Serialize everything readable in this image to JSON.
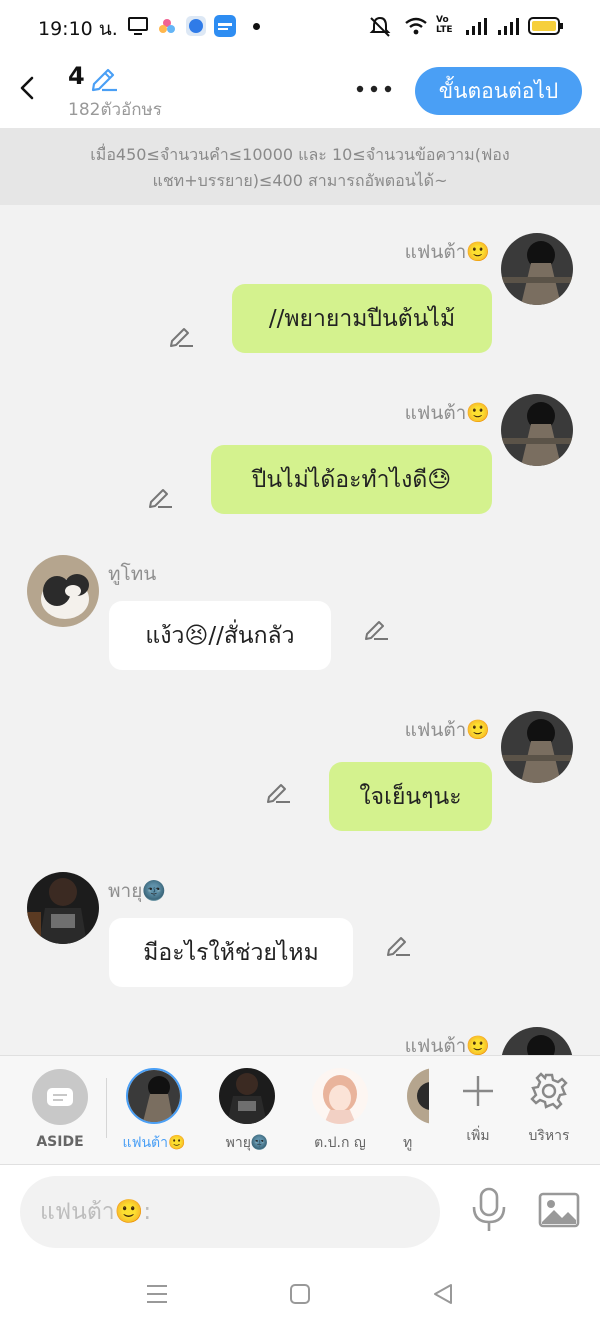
{
  "status": {
    "time": "19:10 น.",
    "volte": "Vo LTE"
  },
  "header": {
    "chapter_number": "4",
    "char_count": "182ตัวอักษร",
    "next_button": "ขั้นตอนต่อไป"
  },
  "notice": {
    "line1": "เมื่อ450≤จำนวนคำ≤10000 และ 10≤จำนวนข้อความ(ฟอง",
    "line2": "แชท+บรรยาย)≤400 สามารถอัพตอนได้~"
  },
  "messages": [
    {
      "side": "right",
      "speaker": "แฟนต้า🙂",
      "text": "//พยายามปีนต้นไม้"
    },
    {
      "side": "right",
      "speaker": "แฟนต้า🙂",
      "text": "ปีนไม่ได้อะทำไงดี😓"
    },
    {
      "side": "left",
      "speaker": "ทูโทน",
      "text": "แง้ว😣//สั่นกลัว"
    },
    {
      "side": "right",
      "speaker": "แฟนต้า🙂",
      "text": "ใจเย็นๆนะ"
    },
    {
      "side": "left",
      "speaker": "พายุ🌚",
      "text": "มีอะไรให้ช่วยไหม"
    },
    {
      "side": "right",
      "speaker": "แฟนต้า🙂",
      "text": ""
    }
  ],
  "characters": {
    "aside_label": "ASIDE",
    "items": [
      {
        "name": "แฟนต้า🙂",
        "active": true
      },
      {
        "name": "พายุ🌚",
        "active": false
      },
      {
        "name": "ต.ป.ก ญ",
        "active": false
      },
      {
        "name": "ทู",
        "active": false
      }
    ],
    "add_label": "เพิ่ม",
    "manage_label": "บริหาร"
  },
  "input": {
    "placeholder": "แฟนต้า🙂:"
  },
  "colors": {
    "accent": "#4a9ff5",
    "bubble_right": "#d4f28e",
    "bubble_left": "#ffffff",
    "background": "#f2f2f2"
  },
  "icons": [
    "back-icon",
    "pencil-icon",
    "more-icon",
    "aside-icon",
    "plus-icon",
    "gear-icon",
    "microphone-icon",
    "image-icon",
    "menu-icon",
    "home-icon",
    "back-triangle-icon"
  ]
}
